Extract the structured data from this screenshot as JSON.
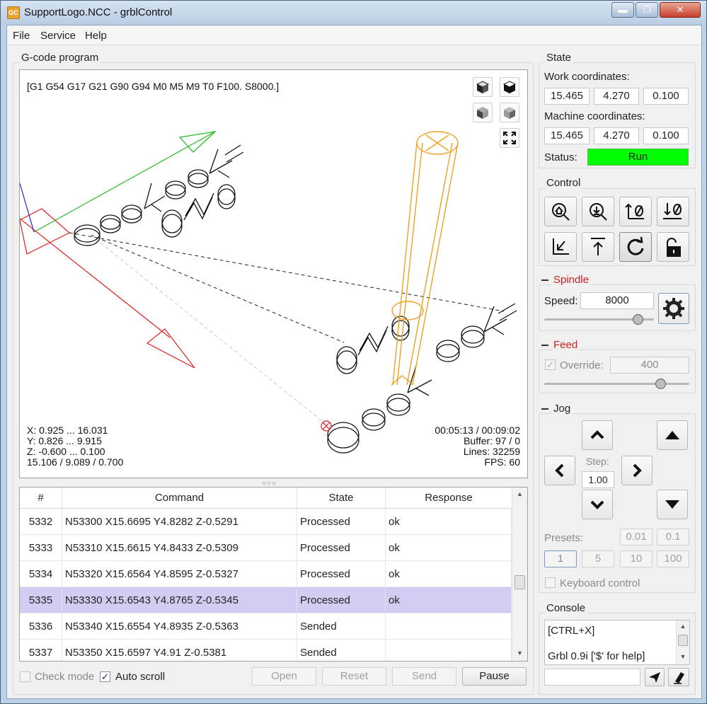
{
  "window": {
    "app_icon": "GC",
    "title": "SupportLogo.NCC - grblControl",
    "controls": {
      "minimize": "▬",
      "maximize": "❐",
      "close": "✕"
    }
  },
  "menu": {
    "file": "File",
    "service": "Service",
    "help": "Help"
  },
  "gcode": {
    "group_title": "G-code program",
    "parser_state": "[G1 G54 G17 G21 G90 G94 M0 M5 M9 T0 F100. S8000.]",
    "bounds": {
      "x": "X: 0.925 ... 16.031",
      "y": "Y: 0.826 ... 9.915",
      "z": "Z: -0.600 ... 0.100",
      "size": "15.106 / 9.089 / 0.700"
    },
    "stats": {
      "time": "00:05:13 / 00:09:02",
      "buffer": "Buffer: 97 / 0",
      "lines": "Lines: 32259",
      "fps": "FPS: 60"
    },
    "view_buttons": [
      "cube-iso-icon",
      "cube-top-icon",
      "cube-front-icon",
      "cube-left-icon",
      "fit-view-icon"
    ],
    "splitter": "○○○"
  },
  "table": {
    "headers": [
      "#",
      "Command",
      "State",
      "Response"
    ],
    "rows": [
      {
        "num": "5332",
        "command": "N53300 X15.6695 Y4.8282 Z-0.5291",
        "state": "Processed",
        "response": "ok"
      },
      {
        "num": "5333",
        "command": "N53310 X15.6615 Y4.8433 Z-0.5309",
        "state": "Processed",
        "response": "ok"
      },
      {
        "num": "5334",
        "command": "N53320 X15.6564 Y4.8595 Z-0.5327",
        "state": "Processed",
        "response": "ok"
      },
      {
        "num": "5335",
        "command": "N53330 X15.6543 Y4.8765 Z-0.5345",
        "state": "Processed",
        "response": "ok"
      },
      {
        "num": "5336",
        "command": "N53340 X15.6554 Y4.8935 Z-0.5363",
        "state": "Sended",
        "response": ""
      },
      {
        "num": "5337",
        "command": "N53350 X15.6597 Y4.91 Z-0.5381",
        "state": "Sended",
        "response": ""
      }
    ],
    "selected_row": 3
  },
  "bottom": {
    "check_mode": "Check mode",
    "auto_scroll": "Auto scroll",
    "auto_scroll_checked": true,
    "check_mark": "✓",
    "open": "Open",
    "reset": "Reset",
    "send": "Send",
    "pause": "Pause"
  },
  "state": {
    "title": "State",
    "work_label": "Work coordinates:",
    "work": [
      "15.465",
      "4.270",
      "0.100"
    ],
    "machine_label": "Machine coordinates:",
    "machine": [
      "15.465",
      "4.270",
      "0.100"
    ],
    "status_label": "Status:",
    "status": "Run",
    "status_color": "#00ff00"
  },
  "control": {
    "title": "Control",
    "buttons": [
      "home-icon",
      "zero-probe-icon",
      "zero-xy-icon",
      "zero-z-icon",
      "restore-origin-icon",
      "safe-position-icon",
      "reset-icon",
      "unlock-icon"
    ]
  },
  "spindle": {
    "title": "Spindle",
    "title_color": "#d42020",
    "speed_label": "Speed:",
    "speed": "8000",
    "slider_fraction": 0.85
  },
  "feed": {
    "title": "Feed",
    "override_label": "Override:",
    "override": "400",
    "override_checked": true,
    "slider_fraction": 0.8
  },
  "jog": {
    "title": "Jog",
    "step_label": "Step:",
    "step": "1.00",
    "presets_label": "Presets:",
    "presets": [
      "0.01",
      "0.1",
      "1",
      "5",
      "10",
      "100"
    ],
    "keyboard_control": "Keyboard control"
  },
  "console": {
    "title": "Console",
    "lines": [
      "[CTRL+X]",
      "Grbl 0.9i ['$' for help]"
    ],
    "input": ""
  }
}
